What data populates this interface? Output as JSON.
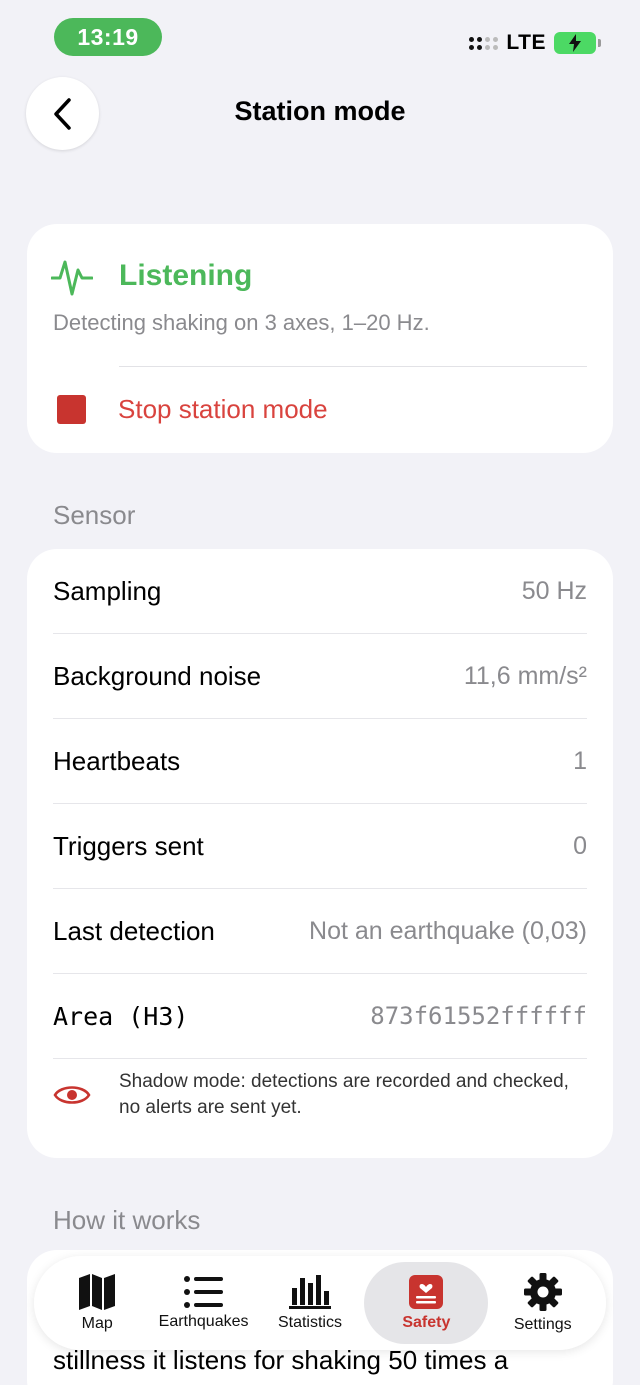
{
  "status_bar": {
    "time": "13:19",
    "network": "LTE"
  },
  "header": {
    "title": "Station mode"
  },
  "status_card": {
    "state": "Listening",
    "description": "Detecting shaking on 3 axes, 1–20 Hz.",
    "stop_label": "Stop station mode"
  },
  "sensor": {
    "section_title": "Sensor",
    "rows": [
      {
        "label": "Sampling",
        "value": "50 Hz"
      },
      {
        "label": "Background noise",
        "value": "11,6 mm/s²"
      },
      {
        "label": "Heartbeats",
        "value": "1"
      },
      {
        "label": "Triggers sent",
        "value": "0"
      },
      {
        "label": "Last detection",
        "value": "Not an earthquake (0,03)"
      },
      {
        "label": "Area (H3)",
        "value": "873f61552ffffff"
      }
    ],
    "shadow_note": "Shadow mode: detections are recorded and checked, no alerts are sent yet."
  },
  "how": {
    "section_title": "How it works",
    "text": "stillness it listens for shaking 50 times a"
  },
  "tabs": [
    {
      "label": "Map",
      "icon": "map-icon"
    },
    {
      "label": "Earthquakes",
      "icon": "list-icon"
    },
    {
      "label": "Statistics",
      "icon": "bar-chart-icon"
    },
    {
      "label": "Safety",
      "icon": "safety-icon",
      "active": true
    },
    {
      "label": "Settings",
      "icon": "gear-icon"
    }
  ],
  "colors": {
    "accent_green": "#4cb85a",
    "accent_red": "#c8342f",
    "background": "#f2f2f7"
  }
}
